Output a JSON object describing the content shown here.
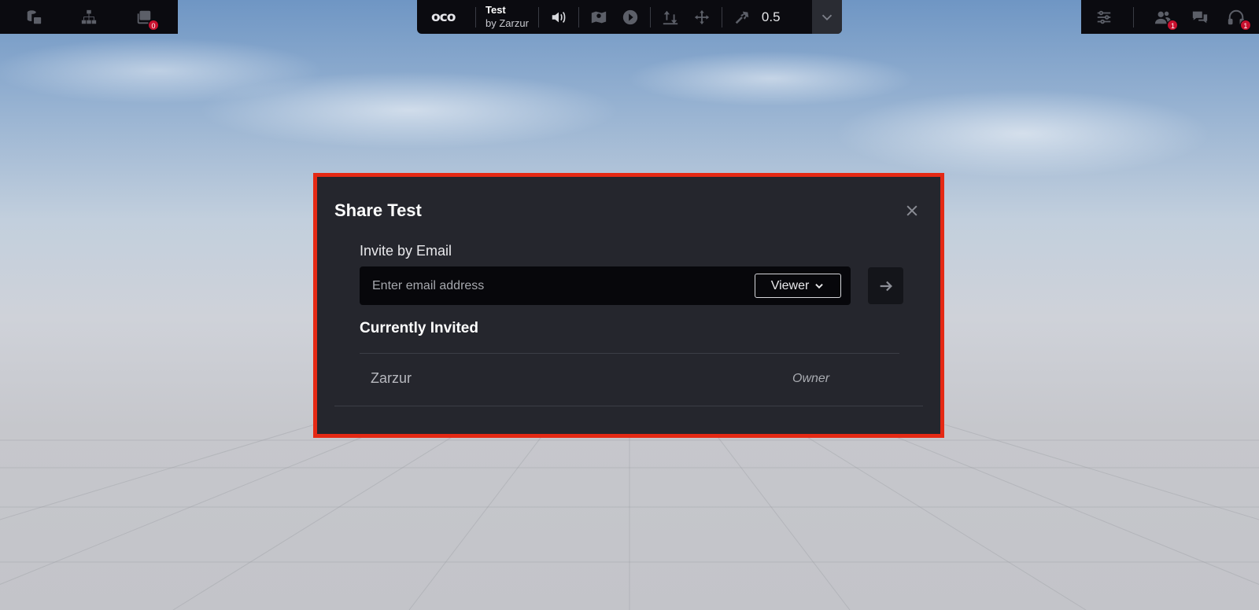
{
  "topbar": {
    "left_badge_count": "0",
    "logo_text": "oco",
    "scene_title": "Test",
    "scene_author": "by Zarzur",
    "speed_value": "0.5",
    "users_badge_count": "1",
    "audio_badge_count": "1"
  },
  "icons": {
    "left": [
      "scene-assets-icon",
      "hierarchy-icon",
      "layers-icon"
    ],
    "center": [
      "volume-icon",
      "map-icon",
      "play-icon",
      "vertical-move-icon",
      "move-icon",
      "fly-speed-icon",
      "chevron-down-icon"
    ],
    "right": [
      "settings-sliders-icon",
      "users-icon",
      "chat-icon",
      "headphones-icon"
    ]
  },
  "modal": {
    "title": "Share Test",
    "invite_label": "Invite by Email",
    "email_placeholder": "Enter email address",
    "email_value": "",
    "role_selected": "Viewer",
    "currently_invited_heading": "Currently Invited",
    "invitees": [
      {
        "name": "Zarzur",
        "role": "Owner"
      }
    ]
  },
  "colors": {
    "modal_bg": "#25262d",
    "modal_border": "#e52914",
    "bar_bg": "#0b0b10",
    "badge": "#c8102e"
  }
}
